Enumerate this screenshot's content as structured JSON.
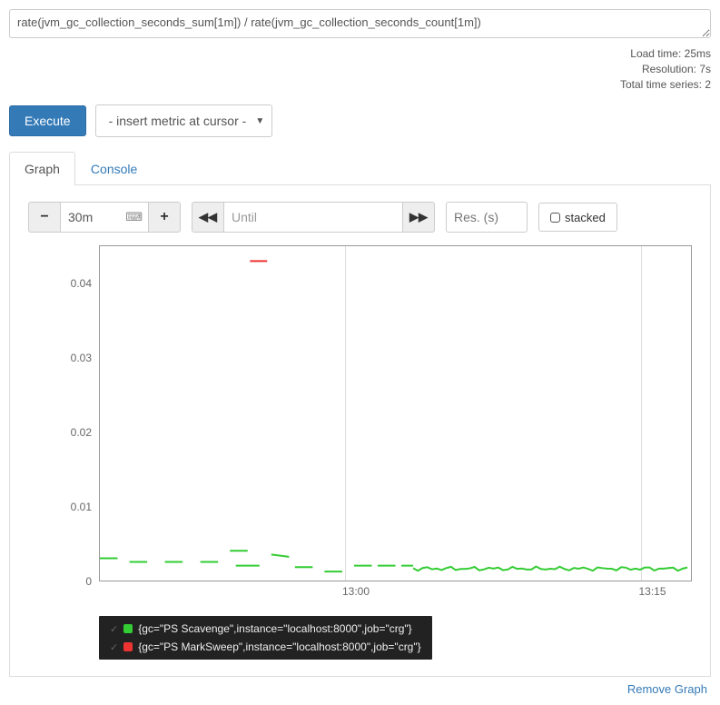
{
  "query": "rate(jvm_gc_collection_seconds_sum[1m]) / rate(jvm_gc_collection_seconds_count[1m])",
  "stats": {
    "load_time": "Load time: 25ms",
    "resolution": "Resolution: 7s",
    "total_series": "Total time series: 2"
  },
  "buttons": {
    "execute": "Execute"
  },
  "metric_select": {
    "placeholder": "- insert metric at cursor -"
  },
  "tabs": {
    "graph": "Graph",
    "console": "Console"
  },
  "range": {
    "value": "30m"
  },
  "until": {
    "placeholder": "Until"
  },
  "res": {
    "placeholder": "Res. (s)"
  },
  "stacked_label": "stacked",
  "chart_data": {
    "type": "line",
    "ylim": [
      0,
      0.045
    ],
    "y_ticks": [
      0,
      0.01,
      0.02,
      0.03,
      0.04
    ],
    "x_ticks": [
      "13:00",
      "13:15"
    ],
    "series": [
      {
        "name": "{gc=\"PS Scavenge\",instance=\"localhost:8000\",job=\"crg\"}",
        "color": "#3c3"
      },
      {
        "name": "{gc=\"PS MarkSweep\",instance=\"localhost:8000\",job=\"crg\"}",
        "color": "#e33"
      }
    ],
    "green_segments": [
      [
        0,
        0.003,
        3,
        0.003
      ],
      [
        5,
        0.0025,
        8,
        0.0025
      ],
      [
        11,
        0.0025,
        14,
        0.0025
      ],
      [
        17,
        0.0025,
        20,
        0.0025
      ],
      [
        22,
        0.004,
        25,
        0.004
      ],
      [
        23,
        0.002,
        27,
        0.002
      ],
      [
        29,
        0.0035,
        32,
        0.0032
      ],
      [
        33,
        0.0018,
        36,
        0.0018
      ],
      [
        38,
        0.0012,
        41,
        0.0012
      ],
      [
        43,
        0.002,
        46,
        0.002
      ],
      [
        47,
        0.002,
        50,
        0.002
      ],
      [
        51,
        0.002,
        53,
        0.002
      ]
    ],
    "green_continuous_start": 53,
    "green_continuous_y": 0.0016,
    "red_segment": [
      25.4,
      0.043,
      28.3,
      0.043
    ]
  },
  "footer": {
    "remove": "Remove Graph"
  }
}
